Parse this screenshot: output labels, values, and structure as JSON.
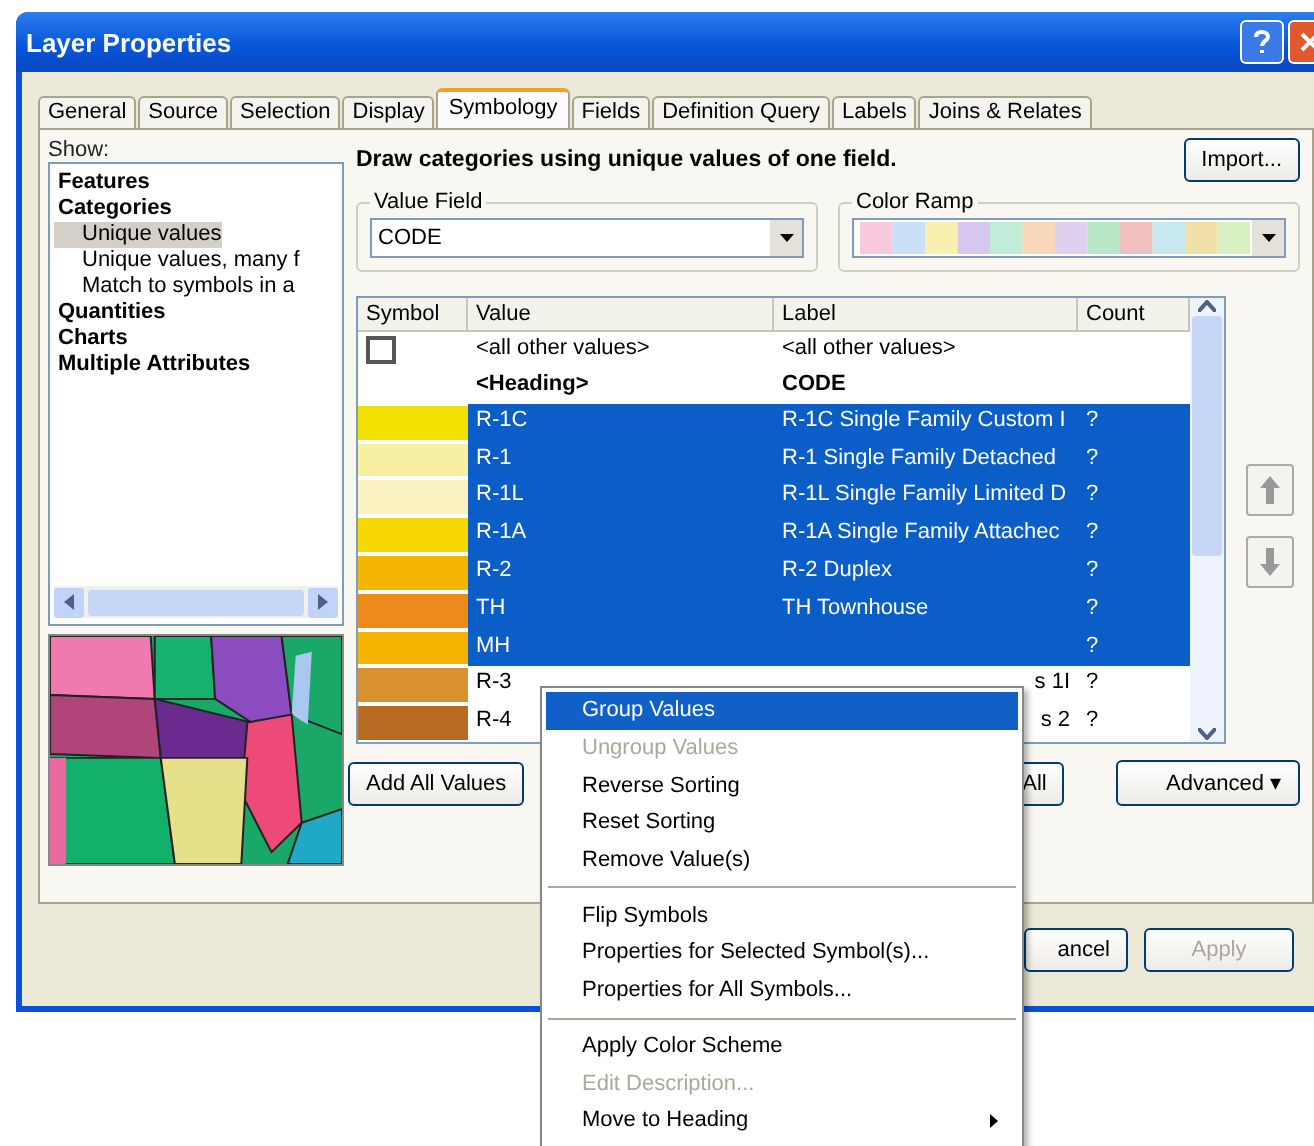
{
  "window": {
    "title": "Layer Properties"
  },
  "tabs": [
    {
      "label": "General",
      "selected": false
    },
    {
      "label": "Source",
      "selected": false
    },
    {
      "label": "Selection",
      "selected": false
    },
    {
      "label": "Display",
      "selected": false
    },
    {
      "label": "Symbology",
      "selected": true
    },
    {
      "label": "Fields",
      "selected": false
    },
    {
      "label": "Definition Query",
      "selected": false
    },
    {
      "label": "Labels",
      "selected": false
    },
    {
      "label": "Joins & Relates",
      "selected": false
    }
  ],
  "show": {
    "label": "Show:",
    "tree": [
      {
        "label": "Features",
        "selected": false
      },
      {
        "label": "Categories",
        "selected": false,
        "children": [
          {
            "label": "Unique values",
            "selected": true
          },
          {
            "label": "Unique values, many f",
            "selected": false
          },
          {
            "label": "Match to symbols in a",
            "selected": false
          }
        ]
      },
      {
        "label": "Quantities",
        "selected": false
      },
      {
        "label": "Charts",
        "selected": false
      },
      {
        "label": "Multiple Attributes",
        "selected": false
      }
    ]
  },
  "heading": "Draw categories using unique values of one field.",
  "import_button": "Import...",
  "value_field": {
    "label": "Value Field",
    "value": "CODE"
  },
  "color_ramp": {
    "label": "Color Ramp"
  },
  "table": {
    "columns": [
      "Symbol",
      "Value",
      "Label",
      "Count"
    ],
    "rows": [
      {
        "kind": "other",
        "value": "<all other values>",
        "label": "<all other values>",
        "selected": false
      },
      {
        "kind": "heading",
        "value": "<Heading>",
        "label": "CODE",
        "selected": false
      },
      {
        "kind": "class",
        "color": "#f2e000",
        "value": "R-1C",
        "label": "R-1C Single Family Custom I",
        "count": "?",
        "selected": true
      },
      {
        "kind": "class",
        "color": "#f7f0a0",
        "value": "R-1",
        "label": "R-1 Single Family Detached",
        "count": "?",
        "selected": true
      },
      {
        "kind": "class",
        "color": "#f9f2c0",
        "value": "R-1L",
        "label": "R-1L Single Family Limited D",
        "count": "?",
        "selected": true
      },
      {
        "kind": "class",
        "color": "#f7d800",
        "value": "R-1A",
        "label": "R-1A Single Family Attachec",
        "count": "?",
        "selected": true
      },
      {
        "kind": "class",
        "color": "#f5b400",
        "value": "R-2",
        "label": "R-2 Duplex",
        "count": "?",
        "selected": true
      },
      {
        "kind": "class",
        "color": "#ee8a1a",
        "value": "TH",
        "label": "TH Townhouse",
        "count": "?",
        "selected": true
      },
      {
        "kind": "class",
        "color": "#f5b200",
        "value": "MH",
        "count": "?",
        "selected": true
      },
      {
        "kind": "class",
        "color": "#d99030",
        "value": "R-3",
        "label": "s 1I",
        "partial": true,
        "count": "?",
        "selected": false
      },
      {
        "kind": "class",
        "color": "#b86a20",
        "value": "R-4",
        "label": "s 2",
        "partial": true,
        "count": "?",
        "selected": false
      }
    ]
  },
  "buttons": [
    {
      "label": "Add All Values"
    },
    {
      "label": "All"
    },
    {
      "label": "Advanced ▾"
    }
  ],
  "dialog_buttons": [
    {
      "label": "ancel",
      "disabled": false
    },
    {
      "label": "Apply",
      "disabled": true
    }
  ],
  "context_menu": [
    {
      "label": "Group Values",
      "selected": true,
      "disabled": false
    },
    {
      "label": "Ungroup Values",
      "selected": false,
      "disabled": true
    },
    {
      "label": "Reverse Sorting",
      "selected": false,
      "disabled": false
    },
    {
      "label": "Reset Sorting",
      "selected": false,
      "disabled": false
    },
    {
      "label": "Remove Value(s)",
      "selected": false,
      "disabled": false
    },
    {
      "kind": "separator"
    },
    {
      "label": "Flip Symbols",
      "selected": false,
      "disabled": false
    },
    {
      "label": "Properties for Selected Symbol(s)...",
      "selected": false,
      "disabled": false
    },
    {
      "label": "Properties for All Symbols...",
      "selected": false,
      "disabled": false
    },
    {
      "kind": "separator"
    },
    {
      "label": "Apply Color Scheme",
      "selected": false,
      "disabled": false
    },
    {
      "label": "Edit Description...",
      "selected": false,
      "disabled": true
    },
    {
      "label": "Move to Heading",
      "selected": false,
      "disabled": false,
      "submenu": true
    }
  ]
}
